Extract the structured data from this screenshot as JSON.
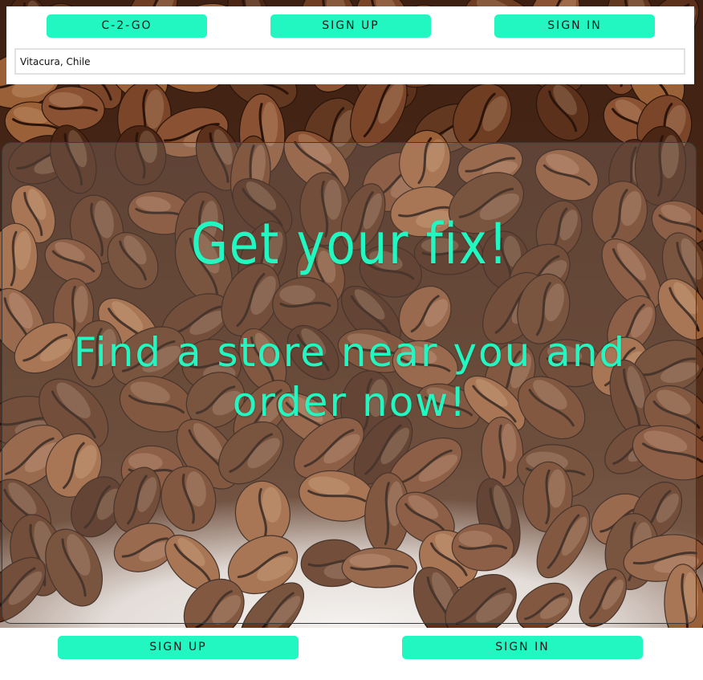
{
  "header": {
    "brand_label": "C-2-GO",
    "signup_label": "SIGN UP",
    "signin_label": "SIGN IN"
  },
  "location": {
    "value": "Vitacura, Chile"
  },
  "hero": {
    "title": "Get your fix!",
    "subtitle": "Find a store near you and order now!"
  },
  "footer": {
    "signup_label": "SIGN UP",
    "signin_label": "SIGN IN"
  },
  "colors": {
    "accent": "#22f7c1",
    "background_image": "coffee-beans"
  }
}
